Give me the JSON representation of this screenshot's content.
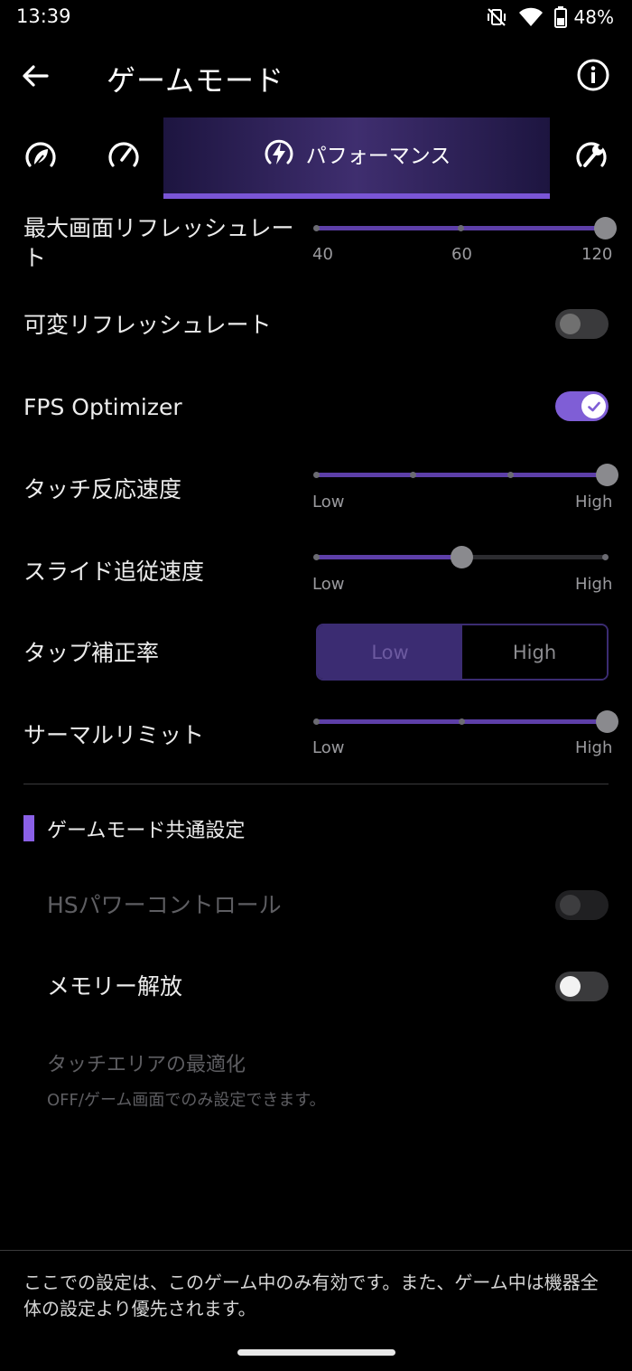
{
  "status_bar": {
    "time": "13:39",
    "battery": "48%"
  },
  "app_bar": {
    "title": "ゲームモード"
  },
  "mode_tabs": {
    "active_label": "パフォーマンス"
  },
  "settings": {
    "max_refresh_rate": {
      "label": "最大画面リフレッシュレート",
      "ticks": [
        "40",
        "60",
        "120"
      ],
      "value": "120"
    },
    "variable_refresh_rate": {
      "label": "可変リフレッシュレート",
      "checked": false
    },
    "fps_optimizer": {
      "label": "FPS Optimizer",
      "checked": true
    },
    "touch_response": {
      "label": "タッチ反応速度",
      "low": "Low",
      "high": "High",
      "level_fraction": 1.0
    },
    "slide_tracking": {
      "label": "スライド追従速度",
      "low": "Low",
      "high": "High",
      "level_fraction": 0.5
    },
    "tap_correction": {
      "label": "タップ補正率",
      "options": [
        "Low",
        "High"
      ],
      "selected": "Low"
    },
    "thermal_limit": {
      "label": "サーマルリミット",
      "low": "Low",
      "high": "High",
      "level_fraction": 1.0
    }
  },
  "common_section": {
    "title": "ゲームモード共通設定",
    "hs_power_control": {
      "label": "HSパワーコントロール",
      "enabled": false
    },
    "memory_release": {
      "label": "メモリー解放",
      "checked": false
    },
    "touch_area": {
      "label": "タッチエリアの最適化",
      "sub": "OFF/ゲーム画面でのみ設定できます。"
    }
  },
  "footer_note": "ここでの設定は、このゲーム中のみ有効です。また、ゲーム中は機器全体の設定より優先されます。",
  "colors": {
    "accent": "#7f5ed6",
    "accent_dark": "#3b2c72",
    "background": "#000000"
  },
  "icons": {
    "mode_tabs": [
      "leaf-mode-icon",
      "gauge-mode-icon",
      "bolt-mode-icon",
      "wrench-gauge-mode-icon"
    ],
    "status": [
      "vibrate-off-icon",
      "wifi-icon",
      "battery-icon"
    ]
  }
}
